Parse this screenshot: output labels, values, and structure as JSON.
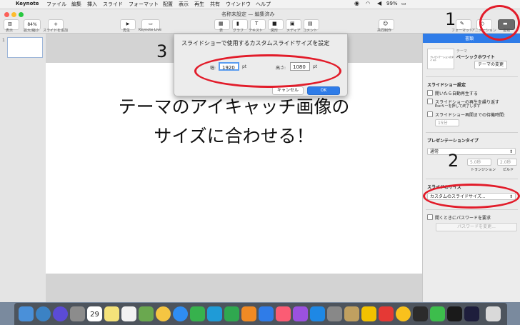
{
  "menubar": {
    "app": "Keynote",
    "items": [
      "ファイル",
      "編集",
      "挿入",
      "スライド",
      "フォーマット",
      "配置",
      "表示",
      "再生",
      "共有",
      "ウインドウ",
      "ヘルプ"
    ],
    "battery": "99%"
  },
  "window": {
    "title": "名称未設定 — 編集済み"
  },
  "toolbar": {
    "zoom": "84%",
    "labels": {
      "view": "表示",
      "zoom": "拡大/縮小",
      "add_slide": "スライドを追加",
      "play": "再生",
      "keynote_live": "Keynote Live",
      "table": "表",
      "chart": "グラフ",
      "text": "テキスト",
      "shape": "図形",
      "media": "メディア",
      "comment": "コメント",
      "collaborate": "共同制作",
      "format": "フォーマット",
      "animate": "アニメーション",
      "document": "書類"
    }
  },
  "navigator": {
    "slide_number": "1"
  },
  "slide": {
    "line1": "テーマのアイキャッチ画像の",
    "line2": "サイズに合わせる！"
  },
  "dialog": {
    "title": "スライドショーで使用するカスタムスライドサイズを設定",
    "width_label": "幅:",
    "width_value": "1920",
    "width_unit": "pt",
    "height_label": "高さ:",
    "height_value": "1080",
    "height_unit": "pt",
    "cancel": "キャンセル",
    "ok": "OK"
  },
  "inspector": {
    "tab": "書類",
    "theme_label": "テーマ",
    "theme_name": "ベーシックホワイト",
    "change_theme": "テーマの変更",
    "slideshow_heading": "スライドショー設定",
    "autoplay": "開いたら自動再生する",
    "loop_line1": "スライドショーの再生を繰り返す",
    "loop_line2": "Escキーを押して終了します",
    "restart": "スライドショー再開までの待機時間:",
    "restart_value": "15分",
    "presentation_type_heading": "プレゼンテーションタイプ",
    "presentation_type": "通常",
    "transition_value": "5.0秒",
    "transition_label": "トランジション",
    "build_value": "2.0秒",
    "build_label": "ビルド",
    "slide_size_heading": "スライドのサイズ",
    "slide_size": "カスタムのスライドサイズ...",
    "password_label": "開くときにパスワードを要求",
    "password_button": "パスワードを変更..."
  },
  "dock": {
    "calendar_day": "29"
  },
  "annotations": {
    "n1": "1",
    "n2": "2",
    "n3": "3"
  },
  "colors": {
    "annotation_red": "#e21c2a",
    "accent_blue": "#2f7ce8"
  }
}
